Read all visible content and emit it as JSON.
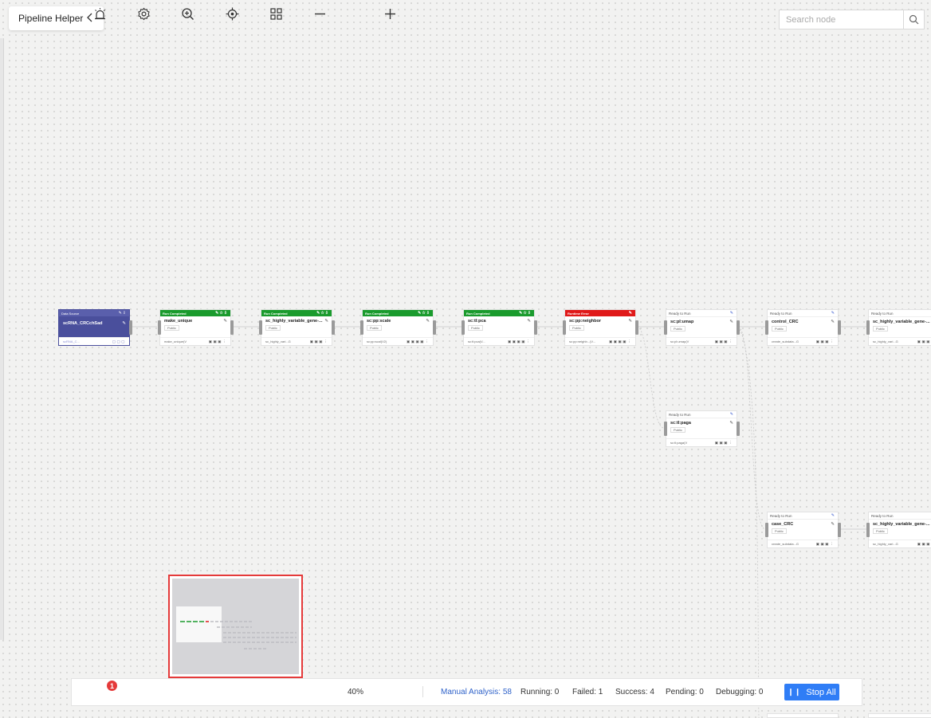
{
  "header": {
    "title": "Pipeline Helper"
  },
  "search": {
    "placeholder": "Search node"
  },
  "nodes": [
    {
      "id": "n0",
      "status": "Data Source",
      "name": "scRNA_CRCchSad",
      "tag": "",
      "footer": "scRNA_C..."
    },
    {
      "id": "n1",
      "status": "Run Completed",
      "name": "make_unique",
      "tag": "Public",
      "footer": "make_unique(V"
    },
    {
      "id": "n2",
      "status": "Run Completed",
      "name": "sc_highly_variable_gene-...",
      "tag": "Public",
      "footer": "sc_highly_vari...G"
    },
    {
      "id": "n3",
      "status": "Run Completed",
      "name": "sc:pp:scale",
      "tag": "Public",
      "footer": "sc:pp:scal(V2)"
    },
    {
      "id": "n4",
      "status": "Run Completed",
      "name": "sc:tl:pca",
      "tag": "Public",
      "footer": "sc:tl:pca(V..."
    },
    {
      "id": "n5",
      "status": "Runtime Error",
      "name": "sc:pp:neighbor",
      "tag": "Public",
      "footer": "sc:pp:neighb...(V..."
    },
    {
      "id": "n6",
      "status": "Ready to Run",
      "name": "sc:pl:umap",
      "tag": "Public",
      "footer": "sc:pl:umap(V"
    },
    {
      "id": "n7",
      "status": "Ready to Run",
      "name": "control_CRC",
      "tag": "Public",
      "footer": "create_subdata...G"
    },
    {
      "id": "n8",
      "status": "Ready to Run",
      "name": "sc_highly_variable_gene-...",
      "tag": "Public",
      "footer": "sc_highly_vari...G"
    },
    {
      "id": "n9",
      "status": "Ready to Run",
      "name": "sc:tl:paga",
      "tag": "Public",
      "footer": "sc:tl:paga(V"
    },
    {
      "id": "n10",
      "status": "Ready to Run",
      "name": "case_CRC",
      "tag": "Public",
      "footer": "create_subdata...G"
    },
    {
      "id": "n11",
      "status": "Ready to Run",
      "name": "sc_highly_variable_gene-...",
      "tag": "Public",
      "footer": "sc_highly_vari...G"
    }
  ],
  "toolbar": {
    "alarm_badge": "1",
    "zoom": "40%",
    "manual_analysis": "Manual Analysis: 58",
    "running": "Running: 0",
    "failed": "Failed: 1",
    "success": "Success: 4",
    "pending": "Pending: 0",
    "debugging": "Debugging: 0",
    "stop_all": "Stop All"
  },
  "colors": {
    "run_completed": "#1a9b2d",
    "runtime_error": "#e01919",
    "data_source": "#4a4f9c",
    "primary": "#2f7df6",
    "minimap_border": "#e53a3a"
  }
}
